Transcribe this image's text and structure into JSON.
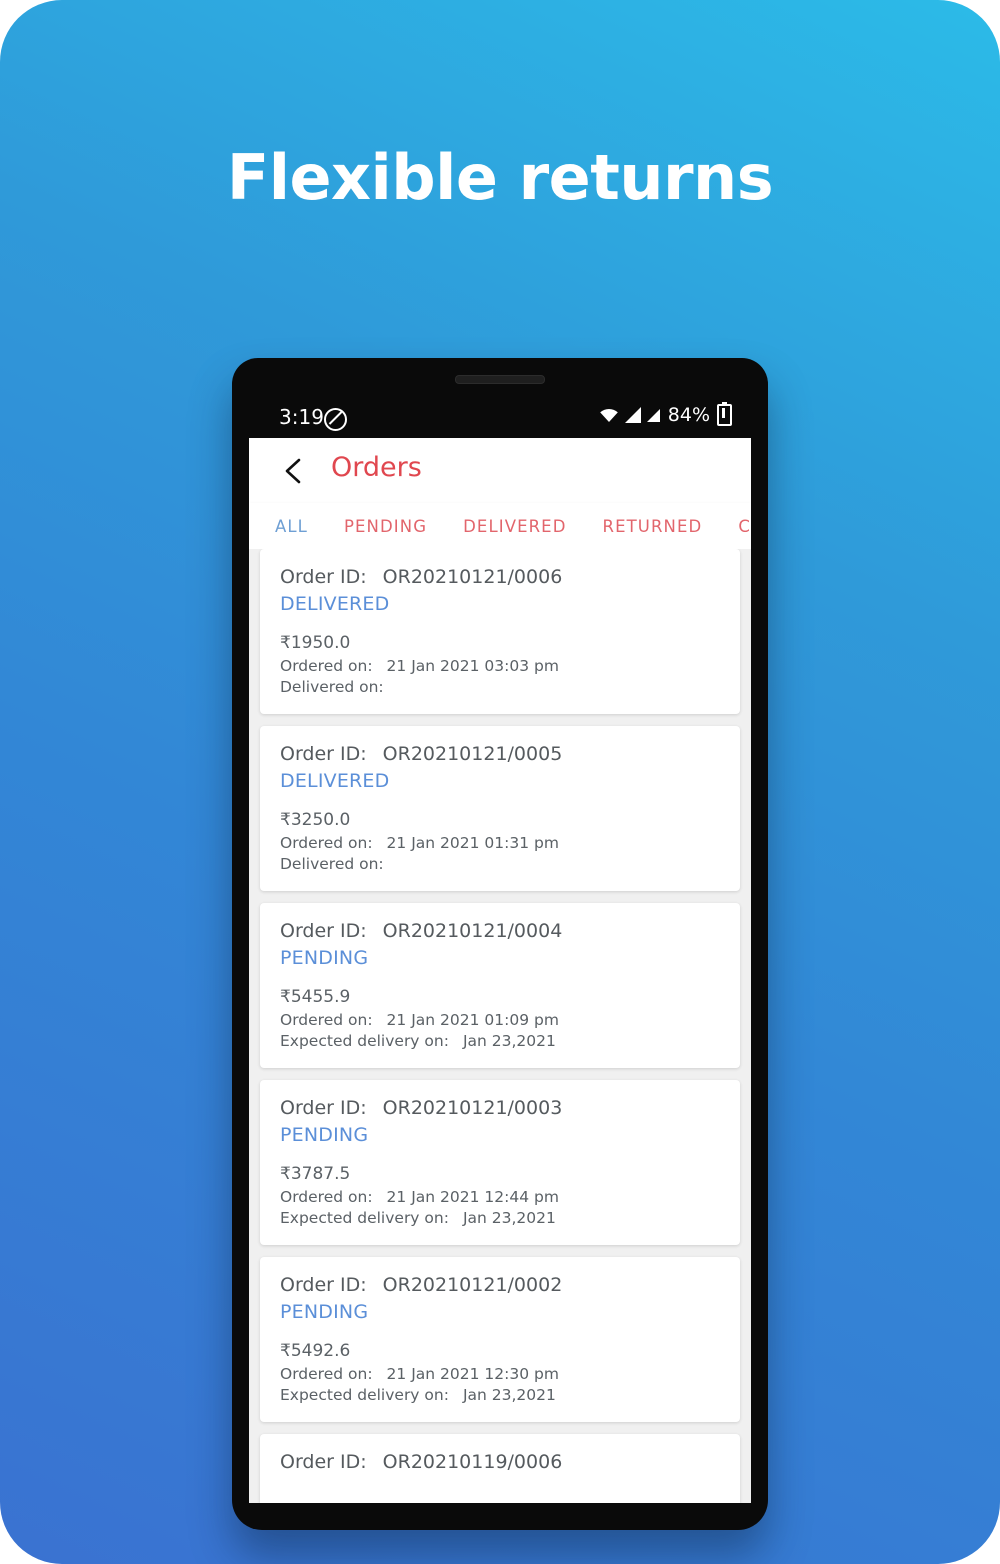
{
  "poster": {
    "headline": "Flexible returns",
    "bg_top_right": "#2cbbe8",
    "bg_bottom_left": "#3a72d1"
  },
  "status_bar": {
    "time": "3:19",
    "dnd_icon": "do-not-disturb-icon",
    "wifi_icon": "wifi-icon",
    "signal_icon": "cell-signal-icon",
    "battery_percent": "84%",
    "battery_icon": "battery-charging-icon"
  },
  "app": {
    "back_icon": "back-chevron-icon",
    "title": "Orders",
    "title_color": "#e0474f",
    "status_color": "#5b8fd8",
    "tabs": [
      {
        "label": "ALL",
        "active": true
      },
      {
        "label": "PENDING",
        "active": false
      },
      {
        "label": "DELIVERED",
        "active": false
      },
      {
        "label": "RETURNED",
        "active": false
      },
      {
        "label": "CA",
        "active": false
      }
    ],
    "labels": {
      "order_id": "Order ID:",
      "ordered_on": "Ordered on:",
      "delivered_on": "Delivered on:",
      "expected_delivery_on": "Expected delivery on:"
    },
    "orders": [
      {
        "order_id": "OR20210121/0006",
        "status": "DELIVERED",
        "amount": "₹1950.0",
        "ordered_on": "21 Jan 2021 03:03 pm",
        "date_label": "Delivered on:",
        "date_value": ""
      },
      {
        "order_id": "OR20210121/0005",
        "status": "DELIVERED",
        "amount": "₹3250.0",
        "ordered_on": "21 Jan 2021 01:31 pm",
        "date_label": "Delivered on:",
        "date_value": ""
      },
      {
        "order_id": "OR20210121/0004",
        "status": "PENDING",
        "amount": "₹5455.9",
        "ordered_on": "21 Jan 2021 01:09 pm",
        "date_label": "Expected delivery on:",
        "date_value": "Jan 23,2021"
      },
      {
        "order_id": "OR20210121/0003",
        "status": "PENDING",
        "amount": "₹3787.5",
        "ordered_on": "21 Jan 2021 12:44 pm",
        "date_label": "Expected delivery on:",
        "date_value": "Jan 23,2021"
      },
      {
        "order_id": "OR20210121/0002",
        "status": "PENDING",
        "amount": "₹5492.6",
        "ordered_on": "21 Jan 2021 12:30 pm",
        "date_label": "Expected delivery on:",
        "date_value": "Jan 23,2021"
      },
      {
        "order_id": "OR20210119/0006",
        "status": "",
        "amount": "",
        "ordered_on": "",
        "date_label": "",
        "date_value": ""
      }
    ]
  }
}
